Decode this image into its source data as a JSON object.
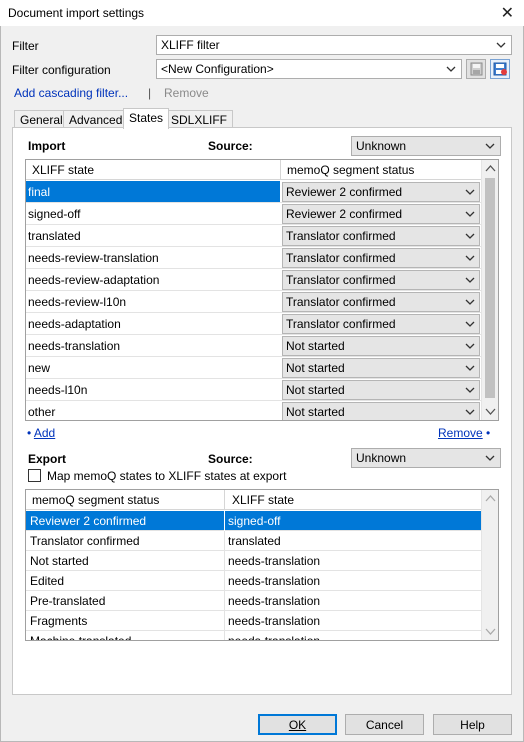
{
  "window": {
    "title": "Document import settings"
  },
  "filter": {
    "label": "Filter",
    "value": "XLIFF filter"
  },
  "filter_config": {
    "label": "Filter configuration",
    "value": "<New Configuration>"
  },
  "actions": {
    "add_cascading": "Add cascading filter...",
    "separator": "|",
    "remove": "Remove"
  },
  "tabs": [
    "General",
    "Advanced",
    "States",
    "SDLXLIFF"
  ],
  "import_section": {
    "heading": "Import",
    "source_label": "Source:",
    "source_value": "Unknown",
    "columns": [
      "XLIFF state",
      "memoQ segment status"
    ],
    "rows": [
      {
        "state": "final",
        "status": "Reviewer 2 confirmed"
      },
      {
        "state": "signed-off",
        "status": "Reviewer 2 confirmed"
      },
      {
        "state": "translated",
        "status": "Translator confirmed"
      },
      {
        "state": "needs-review-translation",
        "status": "Translator confirmed"
      },
      {
        "state": "needs-review-adaptation",
        "status": "Translator confirmed"
      },
      {
        "state": "needs-review-l10n",
        "status": "Translator confirmed"
      },
      {
        "state": "needs-adaptation",
        "status": "Translator confirmed"
      },
      {
        "state": "needs-translation",
        "status": "Not started"
      },
      {
        "state": "new",
        "status": "Not started"
      },
      {
        "state": "needs-l10n",
        "status": "Not started"
      },
      {
        "state": "other",
        "status": "Not started"
      }
    ],
    "add_link": "Add",
    "remove_link": "Remove"
  },
  "export_section": {
    "heading": "Export",
    "source_label": "Source:",
    "source_value": "Unknown",
    "map_checkbox_label": "Map memoQ states to XLIFF states at export",
    "map_checked": false,
    "columns": [
      "memoQ segment status",
      "XLIFF state"
    ],
    "rows": [
      {
        "status": "Reviewer 2 confirmed",
        "state": "signed-off"
      },
      {
        "status": "Translator confirmed",
        "state": "translated"
      },
      {
        "status": "Not started",
        "state": "needs-translation"
      },
      {
        "status": "Edited",
        "state": "needs-translation"
      },
      {
        "status": "Pre-translated",
        "state": "needs-translation"
      },
      {
        "status": "Fragments",
        "state": "needs-translation"
      },
      {
        "status": "Machine translated",
        "state": "needs-translation"
      }
    ]
  },
  "buttons": {
    "ok": "OK",
    "cancel": "Cancel",
    "help": "Help"
  },
  "colors": {
    "selection": "#0078d7",
    "link": "#0033bb"
  }
}
